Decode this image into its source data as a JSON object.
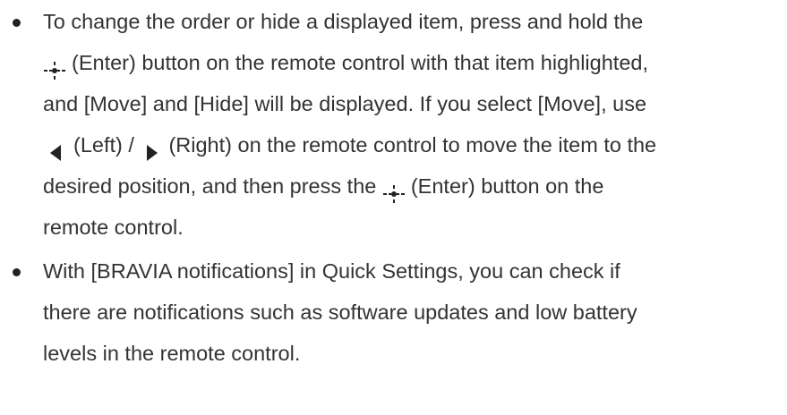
{
  "bullets": [
    {
      "lines": {
        "l1": "To change the order or hide a displayed item, press and hold the",
        "l2": "(Enter) button on the remote control with that item highlighted,",
        "l3": "and [Move] and [Hide] will be displayed. If you select [Move], use",
        "l4a": "(Left) /",
        "l4b": "(Right) on the remote control to move the item to the",
        "l5a": "desired position, and then press the",
        "l5b": "(Enter) button on the",
        "l6": "remote control."
      },
      "icons": [
        "enter-button-icon",
        "left-arrow-icon",
        "right-arrow-icon",
        "enter-button-icon"
      ]
    },
    {
      "lines": {
        "l1": "With [BRAVIA notifications] in Quick Settings, you can check if",
        "l2": "there are notifications such as software updates and low battery",
        "l3": "levels in the remote control."
      }
    }
  ],
  "colors": {
    "text": "#333333",
    "bullet": "#222222",
    "icon": "#222222"
  }
}
